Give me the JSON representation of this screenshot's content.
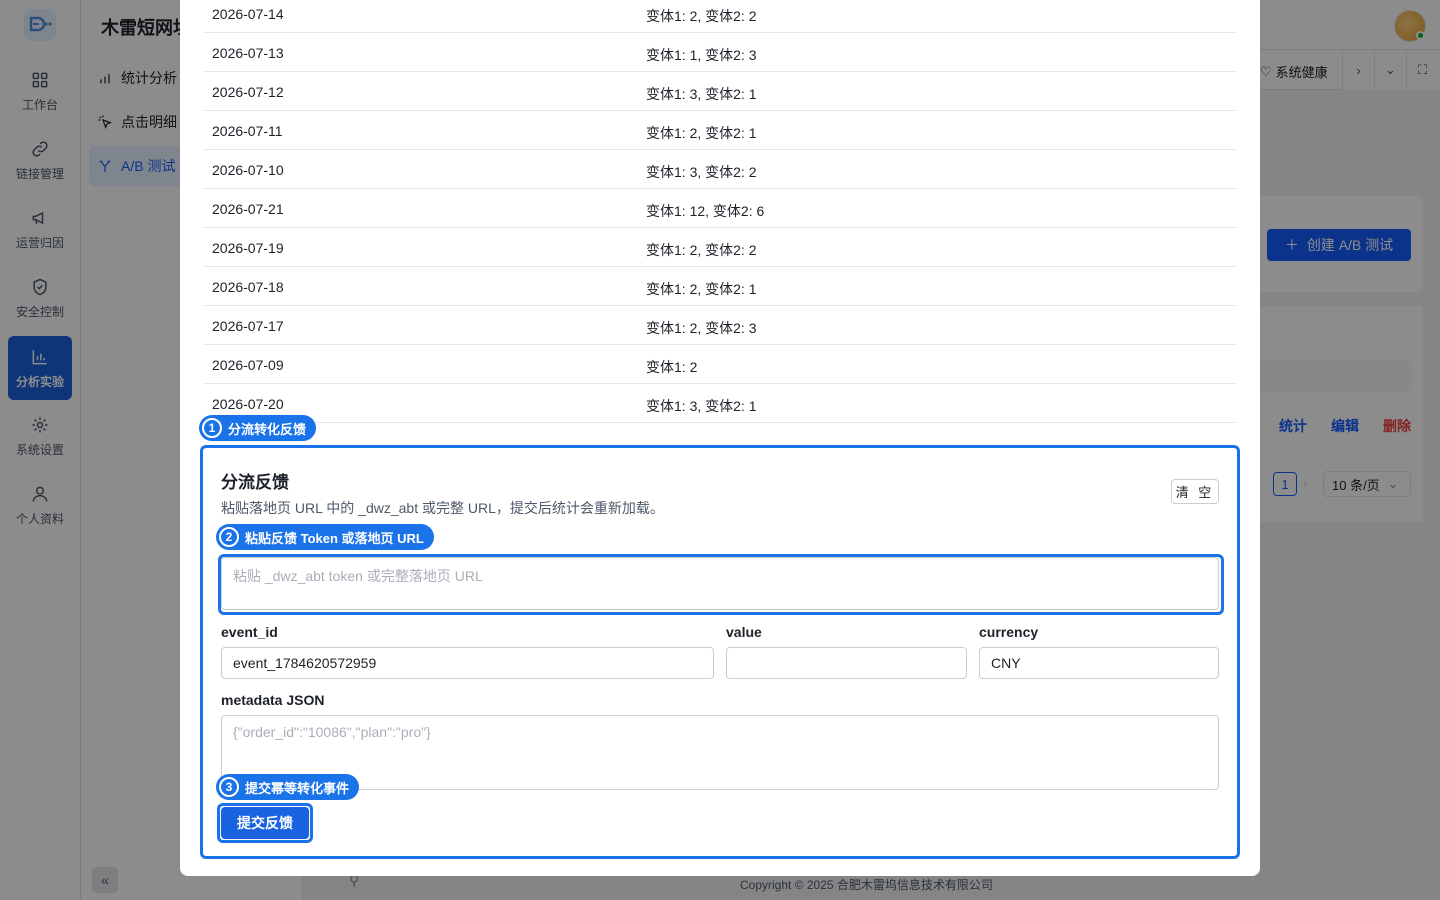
{
  "app": {
    "title": "木雷短网址"
  },
  "rail": {
    "items": [
      {
        "label": "工作台",
        "icon": "dashboard-icon"
      },
      {
        "label": "链接管理",
        "icon": "link-icon"
      },
      {
        "label": "运营归因",
        "icon": "megaphone-icon"
      },
      {
        "label": "安全控制",
        "icon": "shield-icon"
      },
      {
        "label": "分析实验",
        "icon": "bar-chart-icon",
        "active": true
      },
      {
        "label": "系统设置",
        "icon": "gear-icon"
      },
      {
        "label": "个人资料",
        "icon": "user-icon"
      }
    ],
    "collapse_label": "«"
  },
  "subnav": {
    "items": [
      {
        "label": "统计分析",
        "icon": "bar-chart-icon"
      },
      {
        "label": "点击明细",
        "icon": "click-icon"
      },
      {
        "label": "A/B 测试",
        "icon": "split-icon",
        "active": true
      }
    ]
  },
  "header": {
    "health_label": "系统健康"
  },
  "background_page": {
    "create_button": "创建 A/B 测试",
    "row_actions": {
      "stats": "统计",
      "edit": "编辑",
      "delete": "删除"
    },
    "pagination": {
      "current_page": "1",
      "page_size": "10 条/页"
    },
    "footer": "Copyright © 2025 合肥木雷坞信息技术有限公司"
  },
  "modal": {
    "daily_rows": [
      {
        "date": "2026-07-14",
        "counts": "变体1: 2, 变体2: 2"
      },
      {
        "date": "2026-07-13",
        "counts": "变体1: 1, 变体2: 3"
      },
      {
        "date": "2026-07-12",
        "counts": "变体1: 3, 变体2: 1"
      },
      {
        "date": "2026-07-11",
        "counts": "变体1: 2, 变体2: 1"
      },
      {
        "date": "2026-07-10",
        "counts": "变体1: 3, 变体2: 2"
      },
      {
        "date": "2026-07-21",
        "counts": "变体1: 12, 变体2: 6"
      },
      {
        "date": "2026-07-19",
        "counts": "变体1: 2, 变体2: 2"
      },
      {
        "date": "2026-07-18",
        "counts": "变体1: 2, 变体2: 1"
      },
      {
        "date": "2026-07-17",
        "counts": "变体1: 2, 变体2: 3"
      },
      {
        "date": "2026-07-09",
        "counts": "变体1: 2"
      },
      {
        "date": "2026-07-20",
        "counts": "变体1: 3, 变体2: 1"
      }
    ],
    "feedback": {
      "title": "分流反馈",
      "description": "粘贴落地页 URL 中的 _dwz_abt 或完整 URL，提交后统计会重新加载。",
      "clear_button": "清 空",
      "token_placeholder": "粘贴 _dwz_abt token 或完整落地页 URL",
      "token_value": "",
      "event_id_label": "event_id",
      "event_id_value": "event_1784620572959",
      "value_label": "value",
      "value_value": "",
      "currency_label": "currency",
      "currency_value": "CNY",
      "metadata_label": "metadata JSON",
      "metadata_placeholder": "{\"order_id\":\"10086\",\"plan\":\"pro\"}",
      "metadata_value": "",
      "submit_button": "提交反馈"
    },
    "tour_steps": [
      {
        "number": "1",
        "text": "分流转化反馈"
      },
      {
        "number": "2",
        "text": "粘贴反馈 Token 或落地页 URL"
      },
      {
        "number": "3",
        "text": "提交幂等转化事件"
      }
    ]
  },
  "colors": {
    "primary": "#165dff",
    "tour_highlight": "#1a73e8",
    "rail_active": "#1d61dd",
    "danger": "#f53f3f"
  }
}
